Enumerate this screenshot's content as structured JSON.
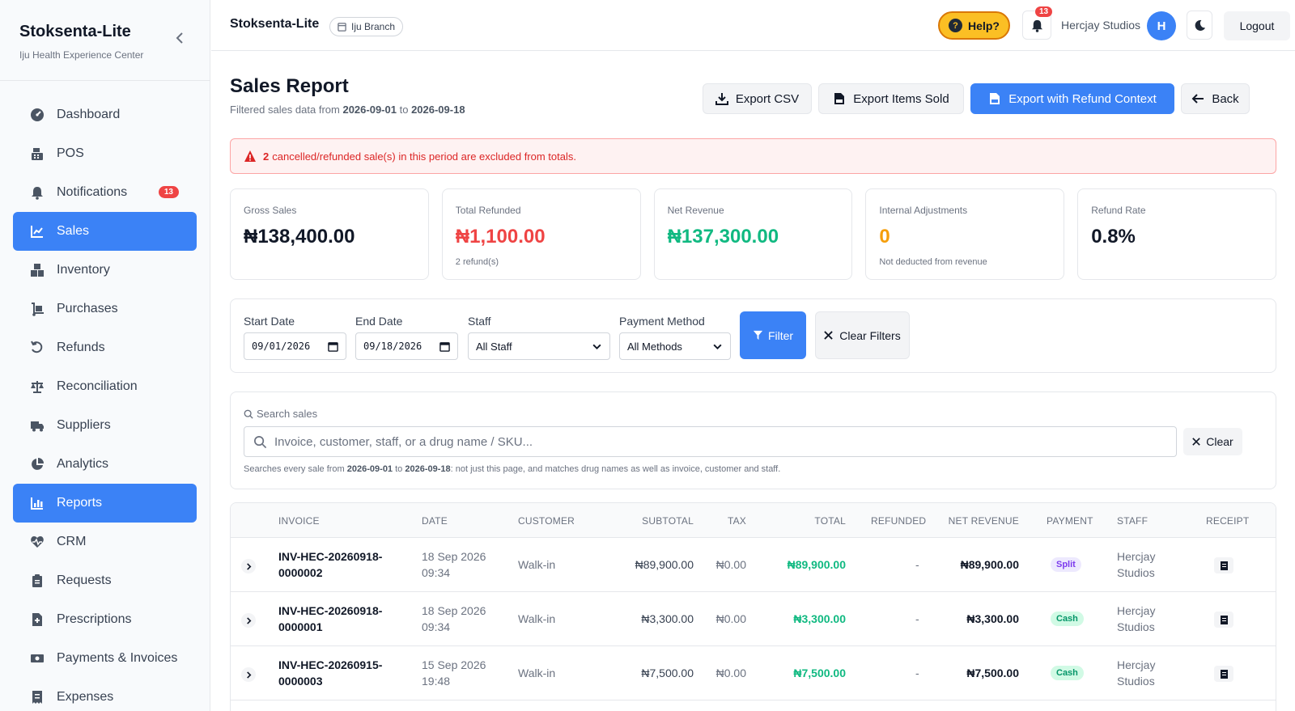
{
  "brand": {
    "title": "Stoksenta-Lite",
    "subtitle": "Iju Health Experience Center"
  },
  "sidebar": {
    "items": [
      {
        "label": "Dashboard",
        "icon": "gauge-icon"
      },
      {
        "label": "POS",
        "icon": "cash-register-icon"
      },
      {
        "label": "Notifications",
        "icon": "bell-icon",
        "badge": "13"
      },
      {
        "label": "Sales",
        "icon": "chart-line-icon",
        "active": true
      },
      {
        "label": "Inventory",
        "icon": "boxes-icon"
      },
      {
        "label": "Purchases",
        "icon": "dolly-icon"
      },
      {
        "label": "Refunds",
        "icon": "undo-icon"
      },
      {
        "label": "Reconciliation",
        "icon": "scale-icon"
      },
      {
        "label": "Suppliers",
        "icon": "truck-icon"
      },
      {
        "label": "Analytics",
        "icon": "pie-chart-icon"
      },
      {
        "label": "Reports",
        "icon": "chart-bar-icon",
        "active": true
      },
      {
        "label": "CRM",
        "icon": "heart-pulse-icon"
      },
      {
        "label": "Requests",
        "icon": "clipboard-icon"
      },
      {
        "label": "Prescriptions",
        "icon": "file-medical-icon"
      },
      {
        "label": "Payments & Invoices",
        "icon": "money-bill-icon"
      },
      {
        "label": "Expenses",
        "icon": "receipt-icon"
      }
    ]
  },
  "topbar": {
    "title": "Stoksenta-Lite",
    "branch": "Iju Branch",
    "help_label": "Help?",
    "notif_count": "13",
    "user_name": "Hercjay Studios",
    "avatar_initial": "H",
    "logout_label": "Logout"
  },
  "page": {
    "title": "Sales Report",
    "sub_prefix": "Filtered sales data from",
    "sub_from": "2026-09-01",
    "sub_to_word": "to",
    "sub_to": "2026-09-18"
  },
  "actions": {
    "export_csv": "Export CSV",
    "export_items": "Export Items Sold",
    "export_refund": "Export with Refund Context",
    "back": "Back"
  },
  "alert": {
    "count": "2",
    "text": "cancelled/refunded sale(s) in this period are excluded from totals."
  },
  "cards": [
    {
      "label": "Gross Sales",
      "value": "₦138,400.00",
      "note": ""
    },
    {
      "label": "Total Refunded",
      "value": "₦1,100.00",
      "note": "2 refund(s)"
    },
    {
      "label": "Net Revenue",
      "value": "₦137,300.00",
      "note": ""
    },
    {
      "label": "Internal Adjustments",
      "value": "0",
      "note": "Not deducted from revenue"
    },
    {
      "label": "Refund Rate",
      "value": "0.8%",
      "note": ""
    }
  ],
  "filters": {
    "start_label": "Start Date",
    "start_value": "09/01/2026",
    "end_label": "End Date",
    "end_value": "09/18/2026",
    "staff_label": "Staff",
    "staff_value": "All Staff",
    "payment_label": "Payment Method",
    "payment_value": "All Methods",
    "filter_button": "Filter",
    "clear_button": "Clear Filters"
  },
  "search": {
    "label": "Search sales",
    "placeholder": "Invoice, customer, staff, or a drug name / SKU...",
    "clear": "Clear",
    "note_prefix": "Searches every sale from",
    "note_from": "2026-09-01",
    "note_to_word": "to",
    "note_to": "2026-09-18",
    "note_suffix": ": not just this page, and matches drug names as well as invoice, customer and staff."
  },
  "table": {
    "headers": {
      "invoice": "INVOICE",
      "date": "DATE",
      "customer": "CUSTOMER",
      "subtotal": "SUBTOTAL",
      "tax": "TAX",
      "total": "TOTAL",
      "refunded": "REFUNDED",
      "net": "NET REVENUE",
      "payment": "PAYMENT",
      "staff": "STAFF",
      "receipt": "RECEIPT"
    },
    "rows": [
      {
        "invoice_1": "INV-HEC-20260918-",
        "invoice_2": "0000002",
        "date_1": "18 Sep 2026",
        "date_2": "09:34",
        "customer": "Walk-in",
        "subtotal": "₦89,900.00",
        "tax": "₦0.00",
        "total": "₦89,900.00",
        "refunded": "-",
        "net": "₦89,900.00",
        "payment": "Split",
        "staff_1": "Hercjay",
        "staff_2": "Studios"
      },
      {
        "invoice_1": "INV-HEC-20260918-",
        "invoice_2": "0000001",
        "date_1": "18 Sep 2026",
        "date_2": "09:34",
        "customer": "Walk-in",
        "subtotal": "₦3,300.00",
        "tax": "₦0.00",
        "total": "₦3,300.00",
        "refunded": "-",
        "net": "₦3,300.00",
        "payment": "Cash",
        "staff_1": "Hercjay",
        "staff_2": "Studios"
      },
      {
        "invoice_1": "INV-HEC-20260915-",
        "invoice_2": "0000003",
        "date_1": "15 Sep 2026",
        "date_2": "19:48",
        "customer": "Walk-in",
        "subtotal": "₦7,500.00",
        "tax": "₦0.00",
        "total": "₦7,500.00",
        "refunded": "-",
        "net": "₦7,500.00",
        "payment": "Cash",
        "staff_1": "Hercjay",
        "staff_2": "Studios"
      }
    ]
  },
  "colors": {
    "primary": "#3b82f6",
    "danger": "#ef4444",
    "success": "#10b981",
    "warning": "#f59e0b"
  }
}
